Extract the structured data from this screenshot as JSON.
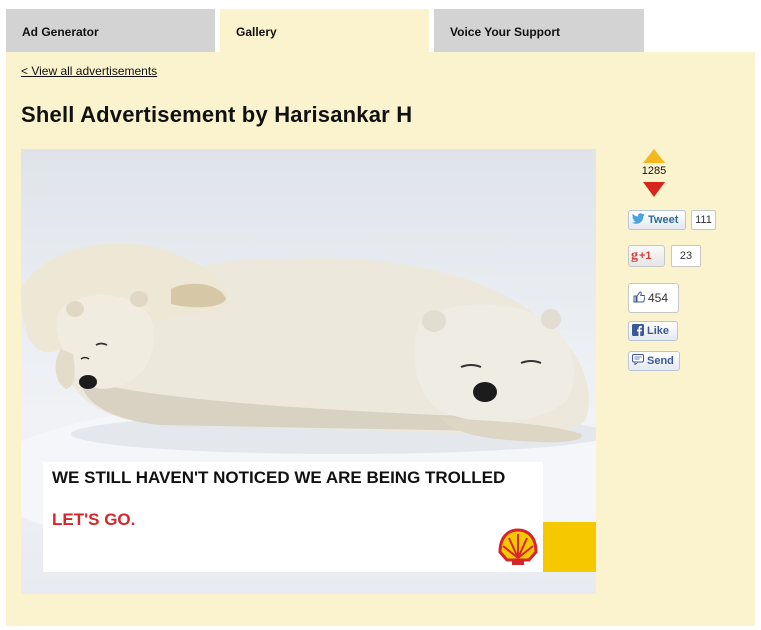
{
  "tabs": [
    {
      "label": "Ad Generator",
      "active": false
    },
    {
      "label": "Gallery",
      "active": true
    },
    {
      "label": "Voice Your Support",
      "active": false
    }
  ],
  "back_link": "< View all advertisements",
  "page_title": "Shell Advertisement by Harisankar H",
  "ad": {
    "line1": "WE STILL HAVEN'T NOTICED WE ARE BEING TROLLED",
    "line2": "LET'S GO.",
    "brand_colors": {
      "red": "#d6262c",
      "yellow": "#f5c800"
    }
  },
  "vote": {
    "count": "1285",
    "up_color": "#f2b81e",
    "down_color": "#d9261c"
  },
  "social": {
    "tweet_label": "Tweet",
    "tweet_count": "111",
    "gplus_label": "+1",
    "gplus_count": "23",
    "like_count": "454",
    "fb_like_label": "Like",
    "fb_send_label": "Send"
  },
  "icons": [
    "twitter-bird-icon",
    "google-g-icon",
    "thumbs-up-icon",
    "facebook-icon",
    "send-icon",
    "shell-logo"
  ]
}
